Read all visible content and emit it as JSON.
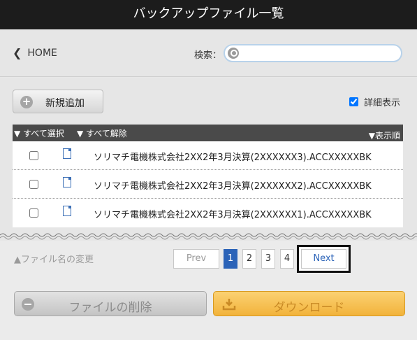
{
  "title": "バックアップファイル一覧",
  "nav": {
    "home_label": "HOME",
    "search_label": "検索：",
    "search_value": "",
    "search_placeholder": ""
  },
  "toolbar": {
    "new_label": "新規追加",
    "detail_label": "詳細表示",
    "detail_checked": true
  },
  "list": {
    "select_all": "▼ すべて選択",
    "deselect_all": "▼ すべて解除",
    "sort_label": "▼表示順",
    "items": [
      {
        "name": "ソリマチ電機株式会社2XX2年3月決算(2XXXXXX3).ACCXXXXXBK",
        "checked": false
      },
      {
        "name": "ソリマチ電機株式会社2XX2年3月決算(2XXXXXX2).ACCXXXXXBK",
        "checked": false
      },
      {
        "name": "ソリマチ電機株式会社2XX2年3月決算(2XXXXXX1).ACCXXXXXBK",
        "checked": false
      }
    ]
  },
  "rename_label": "▲ファイル名の変更",
  "pager": {
    "prev": "Prev",
    "pages": [
      "1",
      "2",
      "3",
      "4"
    ],
    "current_page": 1,
    "next": "Next"
  },
  "actions": {
    "delete_label": "ファイルの削除",
    "download_label": "ダウンロード"
  },
  "colors": {
    "titlebar": "#1c1c1c",
    "active_page": "#2b63b8",
    "download": "#f2b33b"
  }
}
